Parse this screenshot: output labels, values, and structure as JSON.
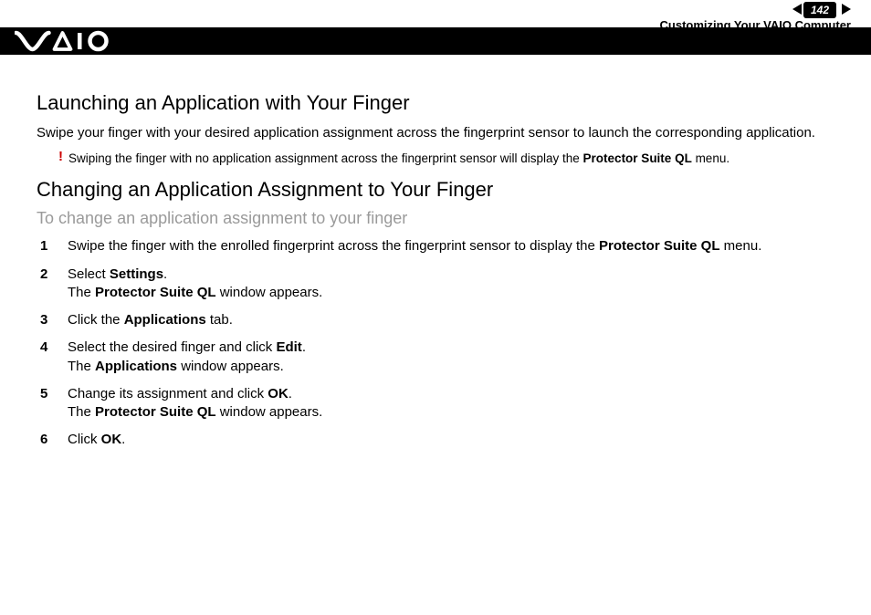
{
  "header": {
    "page_number": "142",
    "breadcrumb": "Customizing Your VAIO Computer"
  },
  "section1": {
    "title": "Launching an Application with Your Finger",
    "body": "Swipe your finger with your desired application assignment across the fingerprint sensor to launch the corresponding application.",
    "note_pre": "Swiping the finger with no application assignment across the fingerprint sensor will display the ",
    "note_bold": "Protector Suite QL",
    "note_post": " menu."
  },
  "section2": {
    "title": "Changing an Application Assignment to Your Finger",
    "subhead": "To change an application assignment to your finger",
    "steps": {
      "s1": {
        "num": "1",
        "a": "Swipe the finger with the enrolled fingerprint across the fingerprint sensor to display the ",
        "b": "Protector Suite QL",
        "c": " menu."
      },
      "s2": {
        "num": "2",
        "a": "Select ",
        "b": "Settings",
        "c": ".",
        "d": "The ",
        "e": "Protector Suite QL",
        "f": " window appears."
      },
      "s3": {
        "num": "3",
        "a": "Click the ",
        "b": "Applications",
        "c": " tab."
      },
      "s4": {
        "num": "4",
        "a": "Select the desired finger and click ",
        "b": "Edit",
        "c": ".",
        "d": "The ",
        "e": "Applications",
        "f": " window appears."
      },
      "s5": {
        "num": "5",
        "a": "Change its assignment and click ",
        "b": "OK",
        "c": ".",
        "d": "The ",
        "e": "Protector Suite QL",
        "f": " window appears."
      },
      "s6": {
        "num": "6",
        "a": "Click ",
        "b": "OK",
        "c": "."
      }
    }
  }
}
